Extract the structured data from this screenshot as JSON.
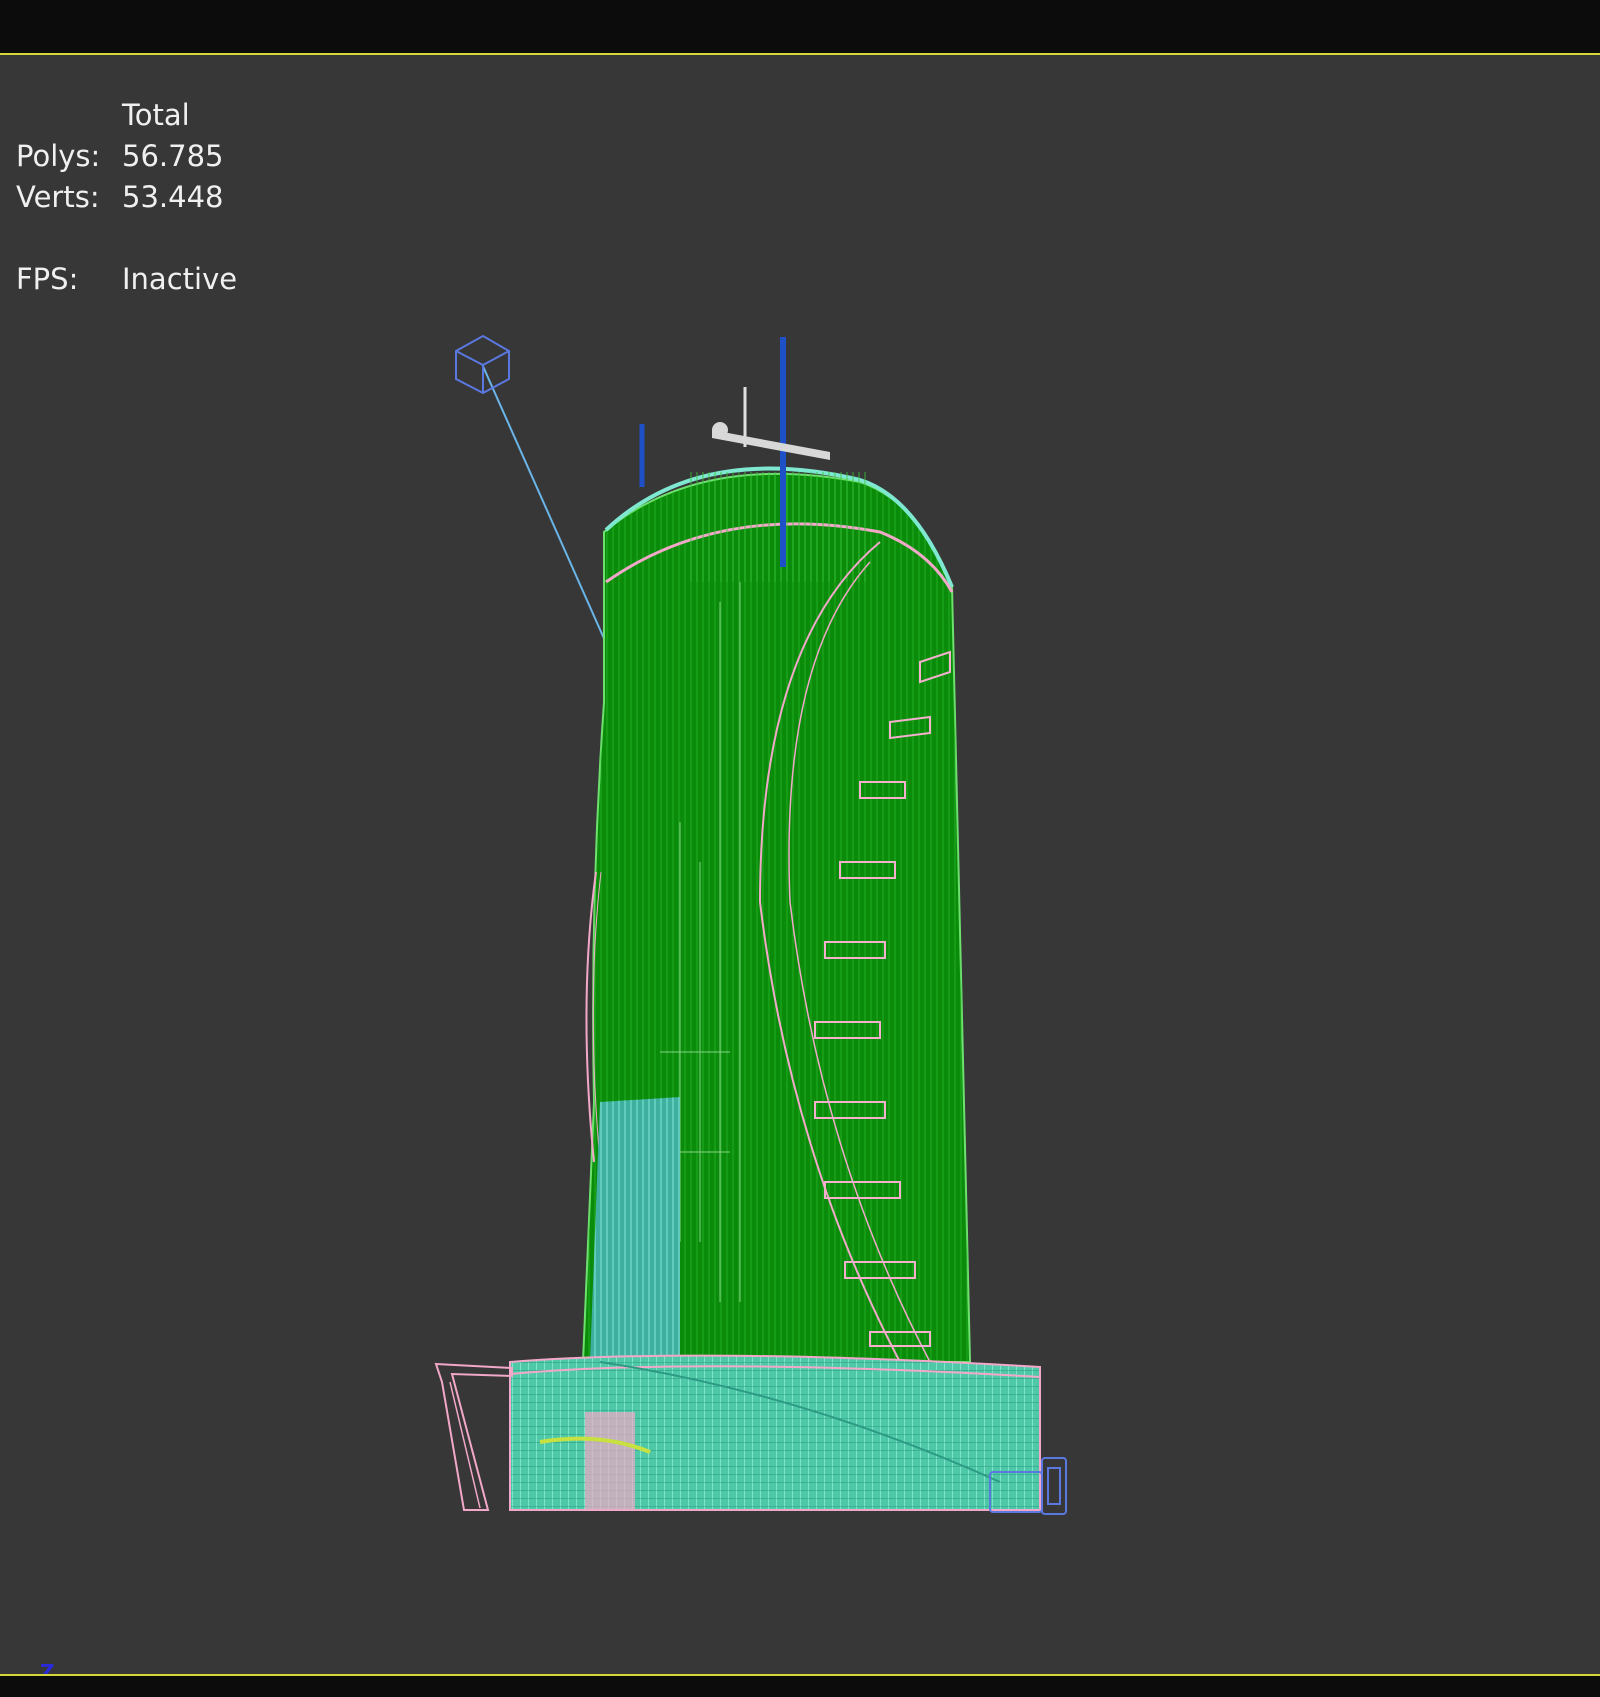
{
  "stats": {
    "header": "Total",
    "polys_label": "Polys:",
    "polys_value": "56.785",
    "verts_label": "Verts:",
    "verts_value": "53.448",
    "fps_label": "FPS:",
    "fps_value": "Inactive"
  },
  "axis": {
    "label": "Z"
  },
  "colors": {
    "viewport_bg": "#373737",
    "frame": "#0c0c0c",
    "border": "#d6d63a",
    "tower_fill": "#0a8a0a",
    "wire_green": "#4fd84f",
    "wire_pink": "#f2a8c8",
    "wire_cyan": "#5fe8c8",
    "wire_blue": "#5a78e0",
    "helper_blue": "#1e50c8"
  },
  "icons": [
    "camera-target-icon",
    "camera-icon"
  ]
}
